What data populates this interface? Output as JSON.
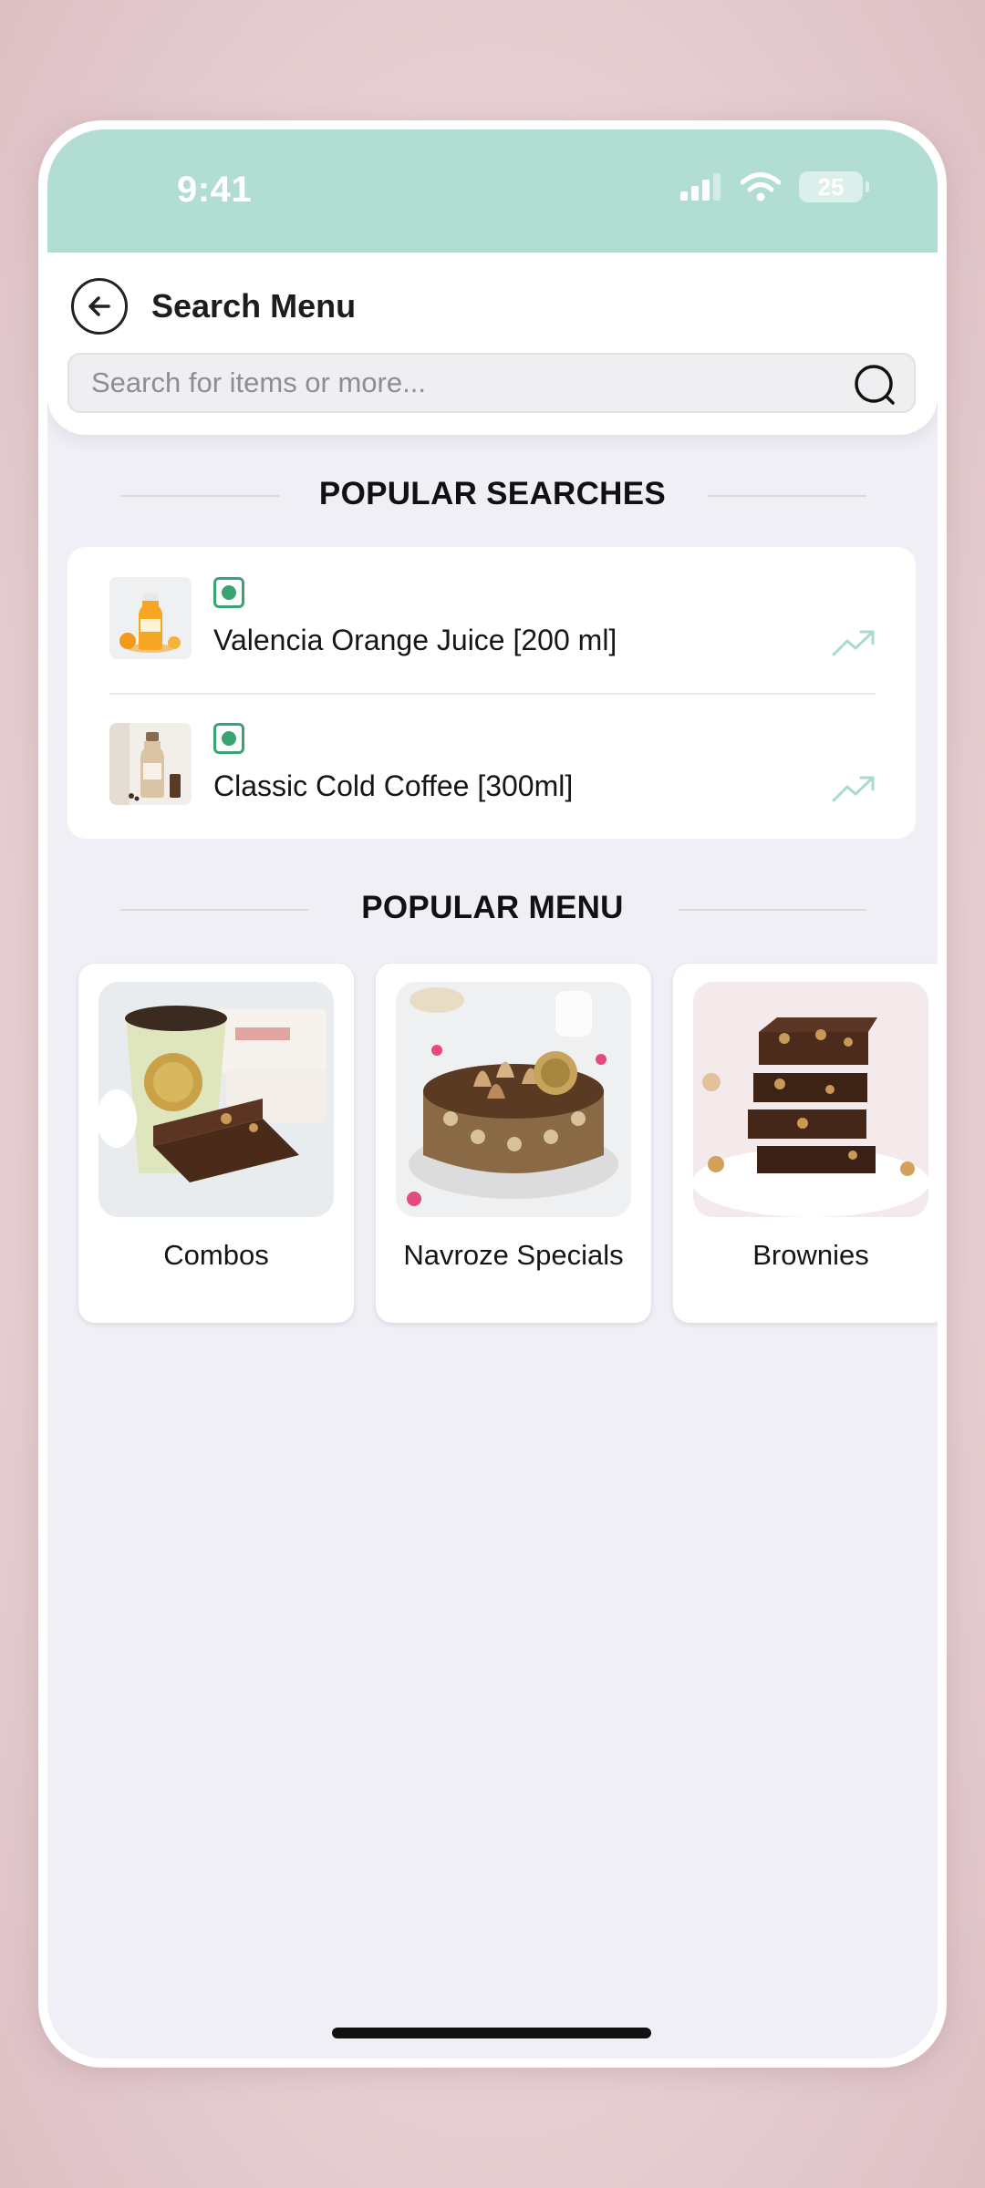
{
  "status_bar": {
    "time": "9:41",
    "battery": "25"
  },
  "header": {
    "title": "Search Menu",
    "back_icon": "arrow-left-circle-icon"
  },
  "search": {
    "placeholder": "Search for items or more...",
    "value": "",
    "icon": "search-icon"
  },
  "popular_searches": {
    "heading": "POPULAR SEARCHES",
    "items": [
      {
        "name": "Valencia Orange Juice [200 ml]",
        "diet_icon": "veg-icon",
        "trend_icon": "trending-up-icon"
      },
      {
        "name": "Classic Cold Coffee [300ml]",
        "diet_icon": "veg-icon",
        "trend_icon": "trending-up-icon"
      }
    ]
  },
  "popular_menu": {
    "heading": "POPULAR MENU",
    "items": [
      {
        "label": "Combos"
      },
      {
        "label": "Navroze Specials"
      },
      {
        "label": "Brownies"
      }
    ]
  },
  "colors": {
    "status_bar": "#b2ddd2",
    "veg_green": "#3aa374",
    "trend_mint": "#a8dcca",
    "screen_bg": "#f0eff5"
  }
}
